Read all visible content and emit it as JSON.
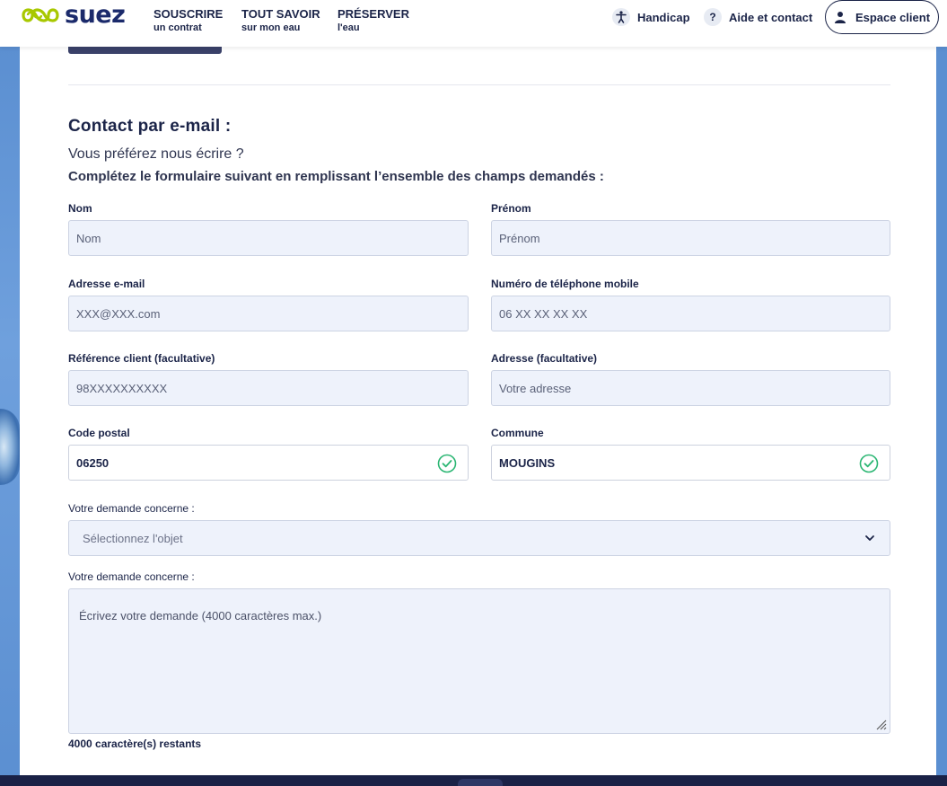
{
  "header": {
    "logo_text": "suez",
    "nav": [
      {
        "main": "SOUSCRIRE",
        "sub": "un contrat"
      },
      {
        "main": "TOUT SAVOIR",
        "sub": "sur mon eau"
      },
      {
        "main": "PRÉSERVER",
        "sub": "l'eau"
      }
    ],
    "handicap_label": "Handicap",
    "handicap_icon": "accessibility-icon",
    "aide_label": "Aide et contact",
    "aide_icon_glyph": "?",
    "espace_label": "Espace client",
    "espace_icon": "user-icon"
  },
  "form": {
    "title": "Contact par e-mail :",
    "intro": "Vous préférez nous écrire ?",
    "instructions": "Complétez le formulaire suivant en remplissant l’ensemble des champs demandés :",
    "nom": {
      "label": "Nom",
      "placeholder": "Nom"
    },
    "prenom": {
      "label": "Prénom",
      "placeholder": "Prénom"
    },
    "email": {
      "label": "Adresse e-mail",
      "placeholder": "XXX@XXX.com"
    },
    "telephone": {
      "label": "Numéro de téléphone mobile",
      "placeholder": "06 XX XX XX XX"
    },
    "reference": {
      "label": "Référence client (facultative)",
      "placeholder": "98XXXXXXXXXX"
    },
    "adresse": {
      "label": "Adresse (facultative)",
      "placeholder": "Votre adresse"
    },
    "code_postal": {
      "label": "Code postal",
      "value": "06250"
    },
    "commune": {
      "label": "Commune",
      "value": "MOUGINS"
    },
    "objet": {
      "label": "Votre demande concerne :",
      "placeholder": "Sélectionnez l'objet"
    },
    "demande": {
      "label": "Votre demande concerne :",
      "placeholder": "Écrivez votre demande (4000 caractères max.)"
    },
    "counter": "4000 caractère(s) restants"
  },
  "colors": {
    "navy": "#1b2448",
    "field_bg": "#eef2fb",
    "valid_green": "#2bb673",
    "page_bg": "#6b98d6"
  }
}
